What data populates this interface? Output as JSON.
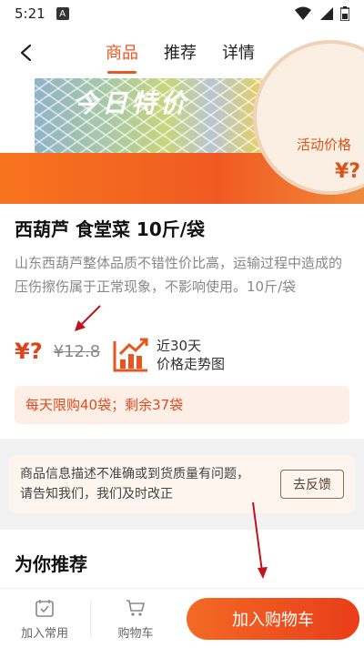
{
  "status_bar": {
    "time": "5:21",
    "app_icon_letter": "A",
    "icons": [
      "notification-icon",
      "wifi-icon",
      "signal-icon",
      "battery-icon"
    ]
  },
  "nav": {
    "tabs": [
      {
        "label": "商品",
        "active": true
      },
      {
        "label": "推荐",
        "active": false
      },
      {
        "label": "详情",
        "active": false
      }
    ],
    "back_icon": "chevron-left-icon",
    "share_icon": "share-icon"
  },
  "banner": {
    "strip_text": "今日特价",
    "circle_label": "活动价格",
    "circle_value": "¥?"
  },
  "product": {
    "title": "西葫芦 食堂菜 10斤/袋",
    "description": "山东西葫芦整体品质不错性价比高，运输过程中造成的压伤擦伤属于正常现象，不影响使用。10斤/袋",
    "price_current": "¥?",
    "price_old": "¥12.8",
    "trend_line1": "近30天",
    "trend_line2": "价格走势图",
    "limit_text": "每天限购40袋；剩余37袋"
  },
  "feedback": {
    "line1": "商品信息描述不准确或到货质量有问题，",
    "line2": "请告知我们，我们及时改正",
    "button": "去反馈"
  },
  "recommend": {
    "title": "为你推荐"
  },
  "bottom_bar": {
    "add_common": "加入常用",
    "cart": "购物车",
    "add_to_cart": "加入购物车"
  },
  "colors": {
    "accent": "#f2541d",
    "price": "#e0421c",
    "annotation": "#c0141c"
  }
}
